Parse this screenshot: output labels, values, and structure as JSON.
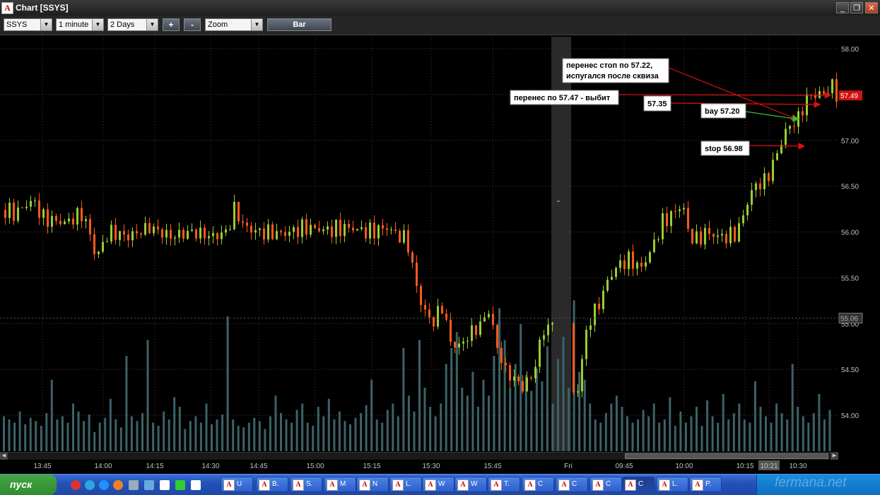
{
  "window": {
    "title": "Chart [SSYS]",
    "min_label": "_",
    "max_label": "❐",
    "close_label": "✕"
  },
  "toolbar": {
    "symbol": "SSYS",
    "interval": "1 minute",
    "period": "2 Days",
    "zoom_in_label": "+",
    "zoom_out_label": "-",
    "zoom_mode": "Zoom",
    "bar_label": "Bar"
  },
  "colors": {
    "up": "#9acd32",
    "down": "#ff5a1a",
    "volume": "#3b6368",
    "grid": "#2a2a2a",
    "axis_text": "#c0c0c0",
    "price_marker": "#d01010",
    "arrow_red": "#e01010",
    "arrow_green": "#30c030"
  },
  "chart_data": {
    "type": "bar",
    "symbol": "SSYS",
    "interval": "1 minute",
    "y_axis": {
      "range": [
        53.7,
        58.1
      ],
      "ticks": [
        "58.00",
        "57.50",
        "57.00",
        "56.50",
        "56.00",
        "55.50",
        "55.00",
        "54.50",
        "54.00"
      ]
    },
    "x_axis": {
      "labels": [
        "13:45",
        "14:00",
        "14:15",
        "14:30",
        "14:45",
        "15:00",
        "15:15",
        "15:30",
        "15:45",
        "Fri",
        "09:45",
        "10:00",
        "10:15",
        "10:21",
        "10:30"
      ]
    },
    "last_price": "57.49",
    "reference_price": "55.06",
    "session_break_label": "Fri",
    "price_path": [
      [
        0,
        56.25
      ],
      [
        20,
        56.2
      ],
      [
        45,
        56.35
      ],
      [
        60,
        56.15
      ],
      [
        90,
        56.1
      ],
      [
        115,
        56.2
      ],
      [
        125,
        56.0
      ],
      [
        135,
        55.7
      ],
      [
        145,
        55.9
      ],
      [
        155,
        56.0
      ],
      [
        180,
        55.95
      ],
      [
        210,
        56.05
      ],
      [
        240,
        55.95
      ],
      [
        270,
        56.0
      ],
      [
        300,
        55.95
      ],
      [
        320,
        56.0
      ],
      [
        330,
        56.25
      ],
      [
        345,
        56.05
      ],
      [
        365,
        56.0
      ],
      [
        400,
        55.98
      ],
      [
        430,
        56.05
      ],
      [
        460,
        56.02
      ],
      [
        490,
        56.05
      ],
      [
        520,
        56.0
      ],
      [
        545,
        56.05
      ],
      [
        575,
        55.9
      ],
      [
        585,
        55.5
      ],
      [
        595,
        55.2
      ],
      [
        610,
        55.0
      ],
      [
        625,
        55.2
      ],
      [
        635,
        54.8
      ],
      [
        648,
        54.75
      ],
      [
        665,
        54.9
      ],
      [
        680,
        55.0
      ],
      [
        690,
        55.15
      ],
      [
        700,
        54.8
      ],
      [
        712,
        54.5
      ],
      [
        725,
        54.4
      ],
      [
        740,
        54.3
      ],
      [
        755,
        54.5
      ],
      [
        765,
        54.9
      ],
      [
        778,
        55.0
      ],
      [
        800,
        54.8
      ],
      [
        812,
        54.1
      ],
      [
        820,
        54.5
      ],
      [
        830,
        55.0
      ],
      [
        845,
        55.2
      ],
      [
        860,
        55.5
      ],
      [
        875,
        55.65
      ],
      [
        890,
        55.7
      ],
      [
        905,
        55.6
      ],
      [
        920,
        55.8
      ],
      [
        935,
        56.1
      ],
      [
        950,
        56.2
      ],
      [
        965,
        56.3
      ],
      [
        972,
        56.0
      ],
      [
        985,
        55.9
      ],
      [
        995,
        56.0
      ],
      [
        1015,
        55.95
      ],
      [
        1030,
        55.95
      ],
      [
        1042,
        56.0
      ],
      [
        1055,
        56.3
      ],
      [
        1065,
        56.5
      ],
      [
        1080,
        56.55
      ],
      [
        1090,
        56.7
      ],
      [
        1100,
        56.9
      ],
      [
        1110,
        57.1
      ],
      [
        1122,
        57.2
      ],
      [
        1130,
        57.25
      ],
      [
        1138,
        57.45
      ],
      [
        1148,
        57.5
      ],
      [
        1160,
        57.5
      ],
      [
        1170,
        57.55
      ],
      [
        1176,
        57.6
      ],
      [
        1182,
        57.49
      ]
    ],
    "volume_bars": [
      22,
      20,
      18,
      25,
      17,
      21,
      19,
      16,
      24,
      45,
      20,
      22,
      18,
      30,
      25,
      19,
      23,
      12,
      18,
      21,
      33,
      20,
      15,
      60,
      22,
      19,
      24,
      70,
      18,
      16,
      25,
      20,
      34,
      28,
      14,
      19,
      22,
      18,
      30,
      17,
      20,
      23,
      85,
      20,
      16,
      15,
      18,
      21,
      19,
      14,
      22,
      35,
      24,
      20,
      18,
      26,
      30,
      18,
      16,
      28,
      22,
      33,
      20,
      25,
      19,
      17,
      21,
      24,
      29,
      45,
      20,
      18,
      26,
      30,
      22,
      65,
      35,
      25,
      70,
      40,
      28,
      22,
      30,
      55,
      65,
      75,
      40,
      35,
      50,
      28,
      45,
      35,
      60,
      90,
      70,
      40,
      55,
      80,
      48,
      38,
      52,
      44,
      66,
      30,
      58,
      72,
      40,
      95,
      50,
      45,
      30,
      20,
      18,
      24,
      30,
      35,
      28,
      22,
      18,
      20,
      26,
      22,
      30,
      18,
      20,
      34,
      16,
      25,
      18,
      22,
      28,
      16,
      32,
      22,
      18,
      36,
      20,
      24,
      30,
      20,
      18,
      44,
      28,
      22,
      18,
      30,
      24,
      20,
      55,
      28,
      22,
      18,
      24,
      36,
      20,
      26
    ],
    "annotations": [
      {
        "lines": [
          "перенес стоп по 57.22,",
          "испугался после сквиза"
        ]
      },
      {
        "lines": [
          "перенес по 57.47 - выбит"
        ]
      },
      {
        "lines": [
          "57.35"
        ]
      },
      {
        "lines": [
          "bay 57.20"
        ]
      },
      {
        "lines": [
          "stop 56.98"
        ]
      }
    ]
  },
  "taskbar": {
    "start_label": "пуск",
    "tasks": [
      {
        "label": "U"
      },
      {
        "label": "B."
      },
      {
        "label": "S."
      },
      {
        "label": "M"
      },
      {
        "label": "N"
      },
      {
        "label": "L."
      },
      {
        "label": "W"
      },
      {
        "label": "W"
      },
      {
        "label": "T."
      },
      {
        "label": "C"
      },
      {
        "label": "C"
      },
      {
        "label": "C"
      },
      {
        "label": "C"
      },
      {
        "label": "L."
      },
      {
        "label": "P."
      }
    ],
    "watermark": "fermana.net"
  }
}
